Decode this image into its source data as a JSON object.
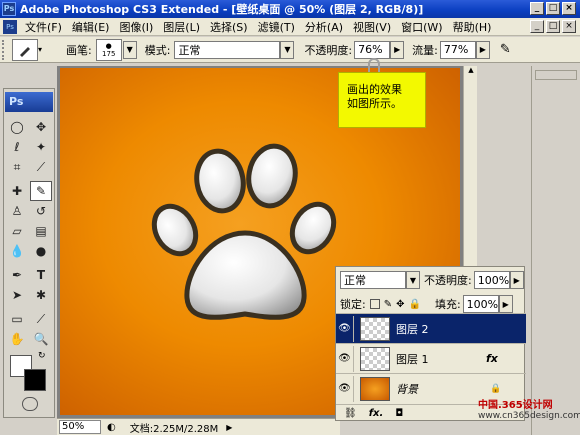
{
  "window": {
    "title": "Adobe Photoshop CS3 Extended - [壁纸桌面 @ 50% (图层 2, RGB/8)]",
    "app_icon": "Ps",
    "controls": [
      "_",
      "□",
      "×"
    ],
    "doc_controls": [
      "_",
      "□",
      "×"
    ]
  },
  "menu": {
    "items": [
      "文件(F)",
      "编辑(E)",
      "图像(I)",
      "图层(L)",
      "选择(S)",
      "滤镜(T)",
      "分析(A)",
      "视图(V)",
      "窗口(W)",
      "帮助(H)"
    ]
  },
  "options": {
    "brush_label": "画笔:",
    "brush_size": "175",
    "mode_label": "模式:",
    "mode_value": "正常",
    "opacity_label": "不透明度:",
    "opacity_value": "76%",
    "flow_label": "流量:",
    "flow_value": "77%"
  },
  "toolbox": {
    "logo": "Ps"
  },
  "note": {
    "line1": "画出的效果",
    "line2": "如图所示。"
  },
  "status": {
    "zoom": "50%",
    "doc_info": "文档:2.25M/2.28M"
  },
  "layers_panel": {
    "blend_mode": "正常",
    "opacity_label": "不透明度:",
    "opacity_value": "100%",
    "lock_label": "锁定:",
    "fill_label": "填充:",
    "fill_value": "100%",
    "layers": [
      {
        "name": "图层 2",
        "selected": true,
        "fx": ""
      },
      {
        "name": "图层 1",
        "selected": false,
        "fx": "fx"
      },
      {
        "name": "背景",
        "selected": false,
        "fx": ""
      }
    ]
  },
  "watermark": {
    "text1": "中国.365设计网",
    "text2": "www.cn365design.com"
  },
  "colors": {
    "title_blue": "#0a3ec0",
    "canvas_orange": "#ee8a00",
    "selected_layer": "#0a246a",
    "note_yellow": "#f3f900"
  }
}
